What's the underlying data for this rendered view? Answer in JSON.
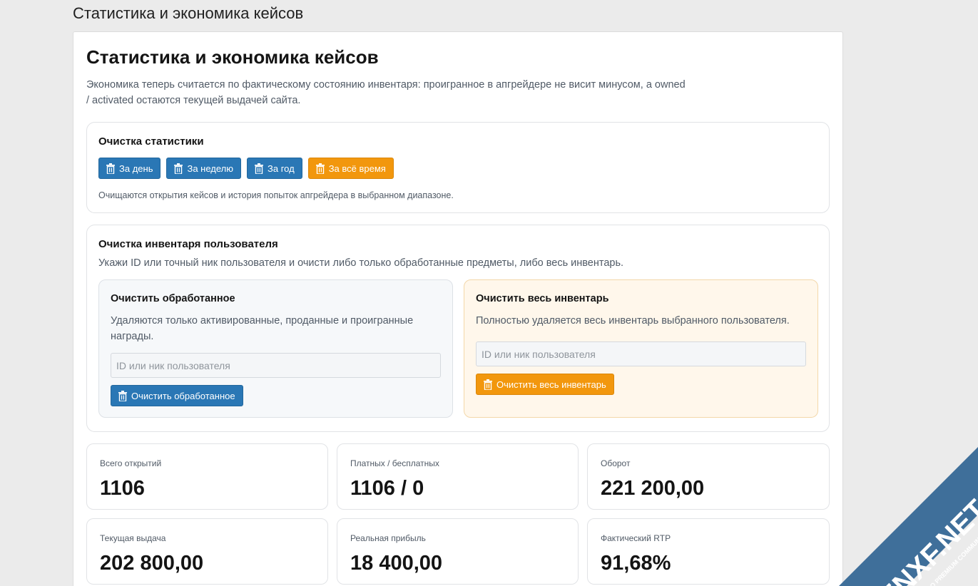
{
  "page_heading": "Статистика и экономика кейсов",
  "panel": {
    "title": "Статистика и экономика кейсов",
    "description": "Экономика теперь считается по фактическому состоянию инвентаря: проигранное в апгрейдере не висит минусом, а owned / activated остаются текущей выдачей сайта."
  },
  "clean_stats": {
    "title": "Очистка статистики",
    "buttons": [
      "За день",
      "За неделю",
      "За год",
      "За всё время"
    ],
    "hint": "Очищаются открытия кейсов и история попыток апгрейдера в выбранном диапазоне."
  },
  "clean_inventory": {
    "title": "Очистка инвентаря пользователя",
    "description": "Укажи ID или точный ник пользователя и очисти либо только обработанные предметы, либо весь инвентарь.",
    "processed": {
      "title": "Очистить обработанное",
      "description": "Удаляются только активированные, проданные и проигранные награды.",
      "placeholder": "ID или ник пользователя",
      "button": "Очистить обработанное"
    },
    "all": {
      "title": "Очистить весь инвентарь",
      "description": "Полностью удаляется весь инвентарь выбранного пользователя.",
      "placeholder": "ID или ник пользователя",
      "button": "Очистить весь инвентарь"
    }
  },
  "stats": [
    {
      "label": "Всего открытий",
      "value": "1106"
    },
    {
      "label": "Платных / бесплатных",
      "value": "1106 / 0"
    },
    {
      "label": "Оборот",
      "value": "221 200,00"
    },
    {
      "label": "Текущая выдача",
      "value": "202 800,00"
    },
    {
      "label": "Реальная прибыль",
      "value": "18 400,00"
    },
    {
      "label": "Фактический RTP",
      "value": "91,68%"
    }
  ],
  "watermark": {
    "main": "ENXF.NET",
    "sub": "XENFORO PREMIUM COMMUNITY"
  },
  "colors": {
    "blue_button": "#2a77b5",
    "orange_button": "#f2970d",
    "watermark_blue": "#3f6f9a"
  }
}
